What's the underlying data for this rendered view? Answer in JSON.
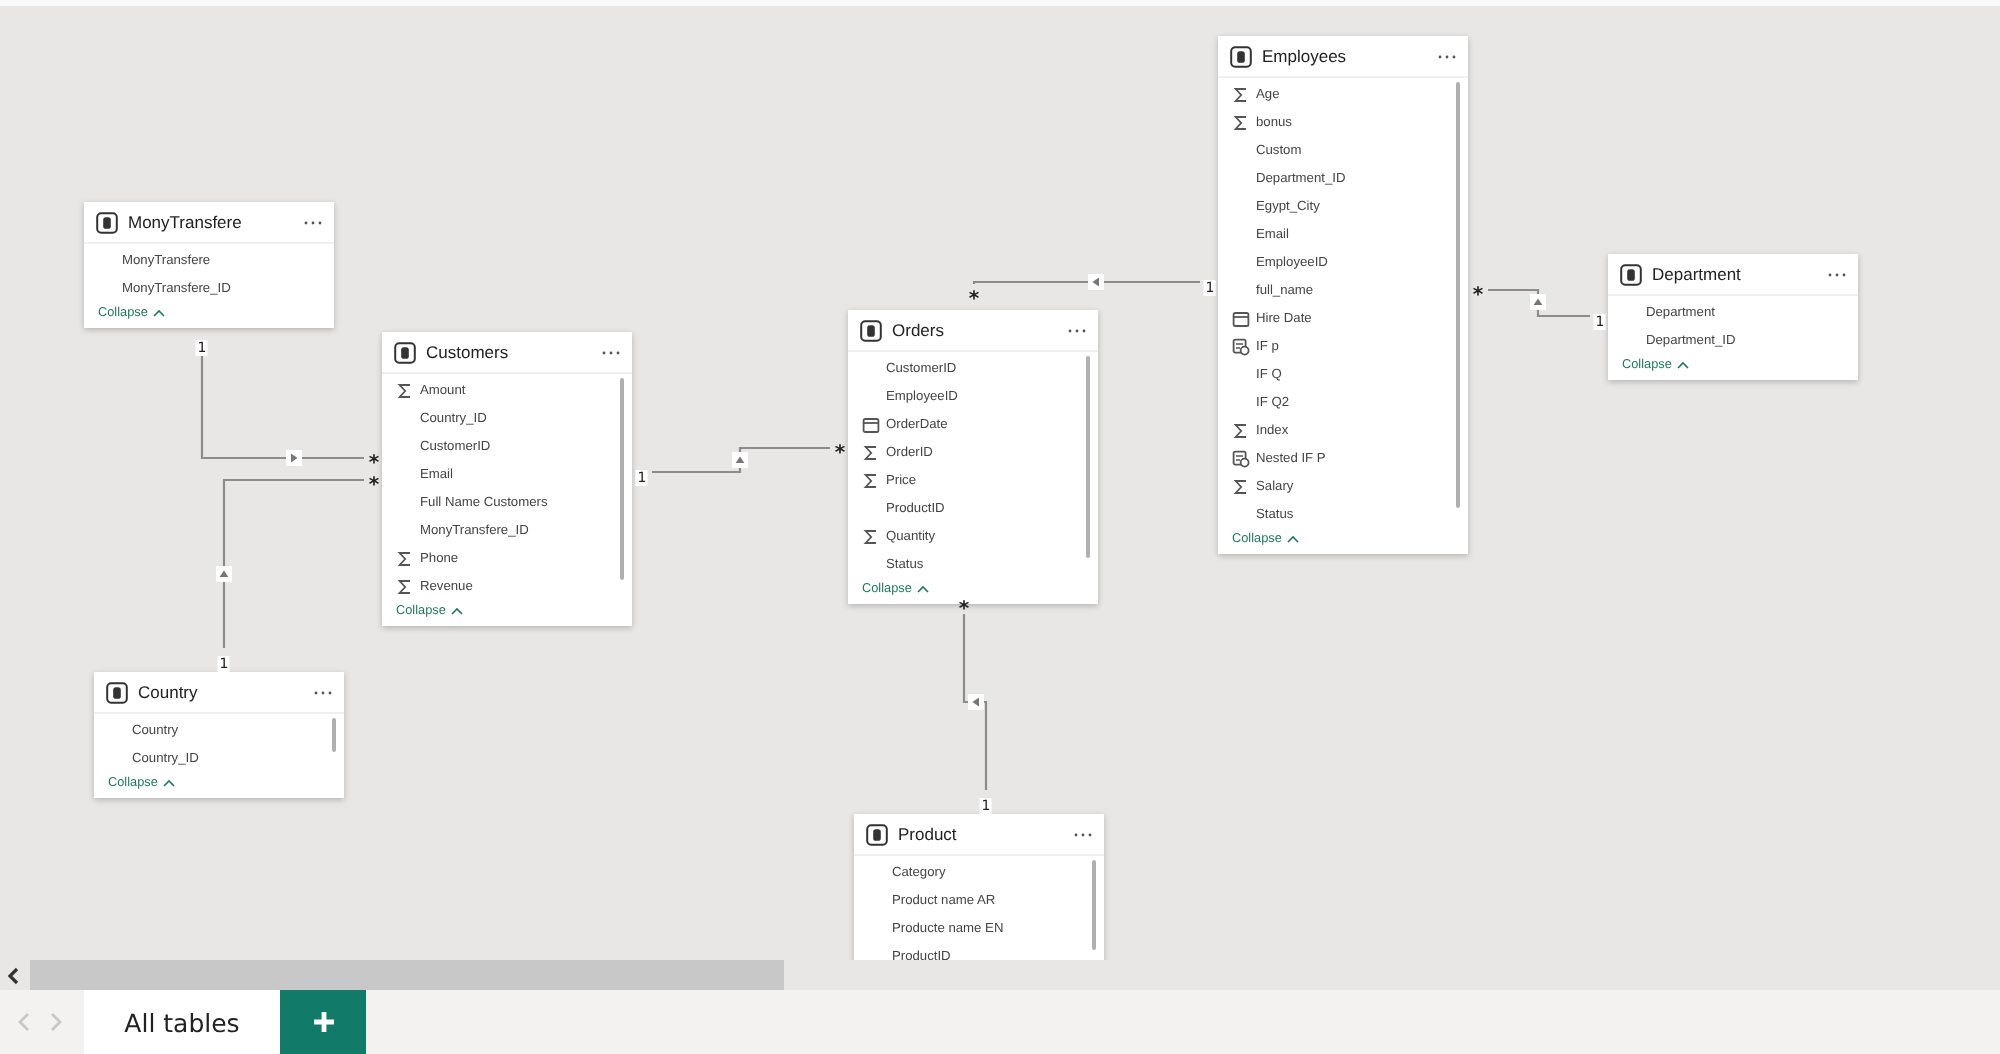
{
  "tables": [
    {
      "title": "MonyTransfere",
      "scrollable": false,
      "fields": [
        {
          "name": "MonyTransfere",
          "kind": "text"
        },
        {
          "name": "MonyTransfere_ID",
          "kind": "text"
        }
      ],
      "collapse": "Collapse"
    },
    {
      "title": "Customers",
      "scrollable": true,
      "fields": [
        {
          "name": "Amount",
          "kind": "sum"
        },
        {
          "name": "Country_ID",
          "kind": "text"
        },
        {
          "name": "CustomerID",
          "kind": "text"
        },
        {
          "name": "Email",
          "kind": "text"
        },
        {
          "name": "Full Name Customers",
          "kind": "text"
        },
        {
          "name": "MonyTransfere_ID",
          "kind": "text"
        },
        {
          "name": "Phone",
          "kind": "sum"
        },
        {
          "name": "Revenue",
          "kind": "sum"
        }
      ],
      "collapse": "Collapse"
    },
    {
      "title": "Country",
      "scrollable": true,
      "fields": [
        {
          "name": "Country",
          "kind": "text"
        },
        {
          "name": "Country_ID",
          "kind": "text"
        }
      ],
      "collapse": "Collapse"
    },
    {
      "title": "Orders",
      "scrollable": true,
      "fields": [
        {
          "name": "CustomerID",
          "kind": "text"
        },
        {
          "name": "EmployeeID",
          "kind": "text"
        },
        {
          "name": "OrderDate",
          "kind": "date"
        },
        {
          "name": "OrderID",
          "kind": "sum"
        },
        {
          "name": "Price",
          "kind": "sum"
        },
        {
          "name": "ProductID",
          "kind": "text"
        },
        {
          "name": "Quantity",
          "kind": "sum"
        },
        {
          "name": "Status",
          "kind": "text"
        }
      ],
      "collapse": "Collapse"
    },
    {
      "title": "Employees",
      "scrollable": true,
      "fields": [
        {
          "name": "Age",
          "kind": "sum"
        },
        {
          "name": "bonus",
          "kind": "sum"
        },
        {
          "name": "Custom",
          "kind": "text"
        },
        {
          "name": "Department_ID",
          "kind": "text"
        },
        {
          "name": "Egypt_City",
          "kind": "text"
        },
        {
          "name": "Email",
          "kind": "text"
        },
        {
          "name": "EmployeeID",
          "kind": "text"
        },
        {
          "name": "full_name",
          "kind": "text"
        },
        {
          "name": "Hire Date",
          "kind": "date"
        },
        {
          "name": "IF p",
          "kind": "calc"
        },
        {
          "name": "IF Q",
          "kind": "text"
        },
        {
          "name": "IF Q2",
          "kind": "text"
        },
        {
          "name": "Index",
          "kind": "sum"
        },
        {
          "name": "Nested IF P",
          "kind": "calc"
        },
        {
          "name": "Salary",
          "kind": "sum"
        },
        {
          "name": "Status",
          "kind": "text"
        }
      ],
      "collapse": "Collapse"
    },
    {
      "title": "Department",
      "scrollable": false,
      "fields": [
        {
          "name": "Department",
          "kind": "text"
        },
        {
          "name": "Department_ID",
          "kind": "text"
        }
      ],
      "collapse": "Collapse"
    },
    {
      "title": "Product",
      "scrollable": true,
      "fields": [
        {
          "name": "Category",
          "kind": "text"
        },
        {
          "name": "Product name AR",
          "kind": "text"
        },
        {
          "name": "Producte name EN",
          "kind": "text"
        },
        {
          "name": "ProductID",
          "kind": "text"
        }
      ]
    }
  ],
  "relationships": [
    {
      "one": "1",
      "many": "*"
    },
    {
      "one": "1",
      "many": "*"
    },
    {
      "one": "1",
      "many": "*"
    },
    {
      "one": "1",
      "many": "*"
    },
    {
      "one": "1",
      "many": "*"
    },
    {
      "one": "1",
      "many": "*"
    }
  ],
  "tabs": [
    {
      "label": "All tables",
      "selected": true
    }
  ]
}
